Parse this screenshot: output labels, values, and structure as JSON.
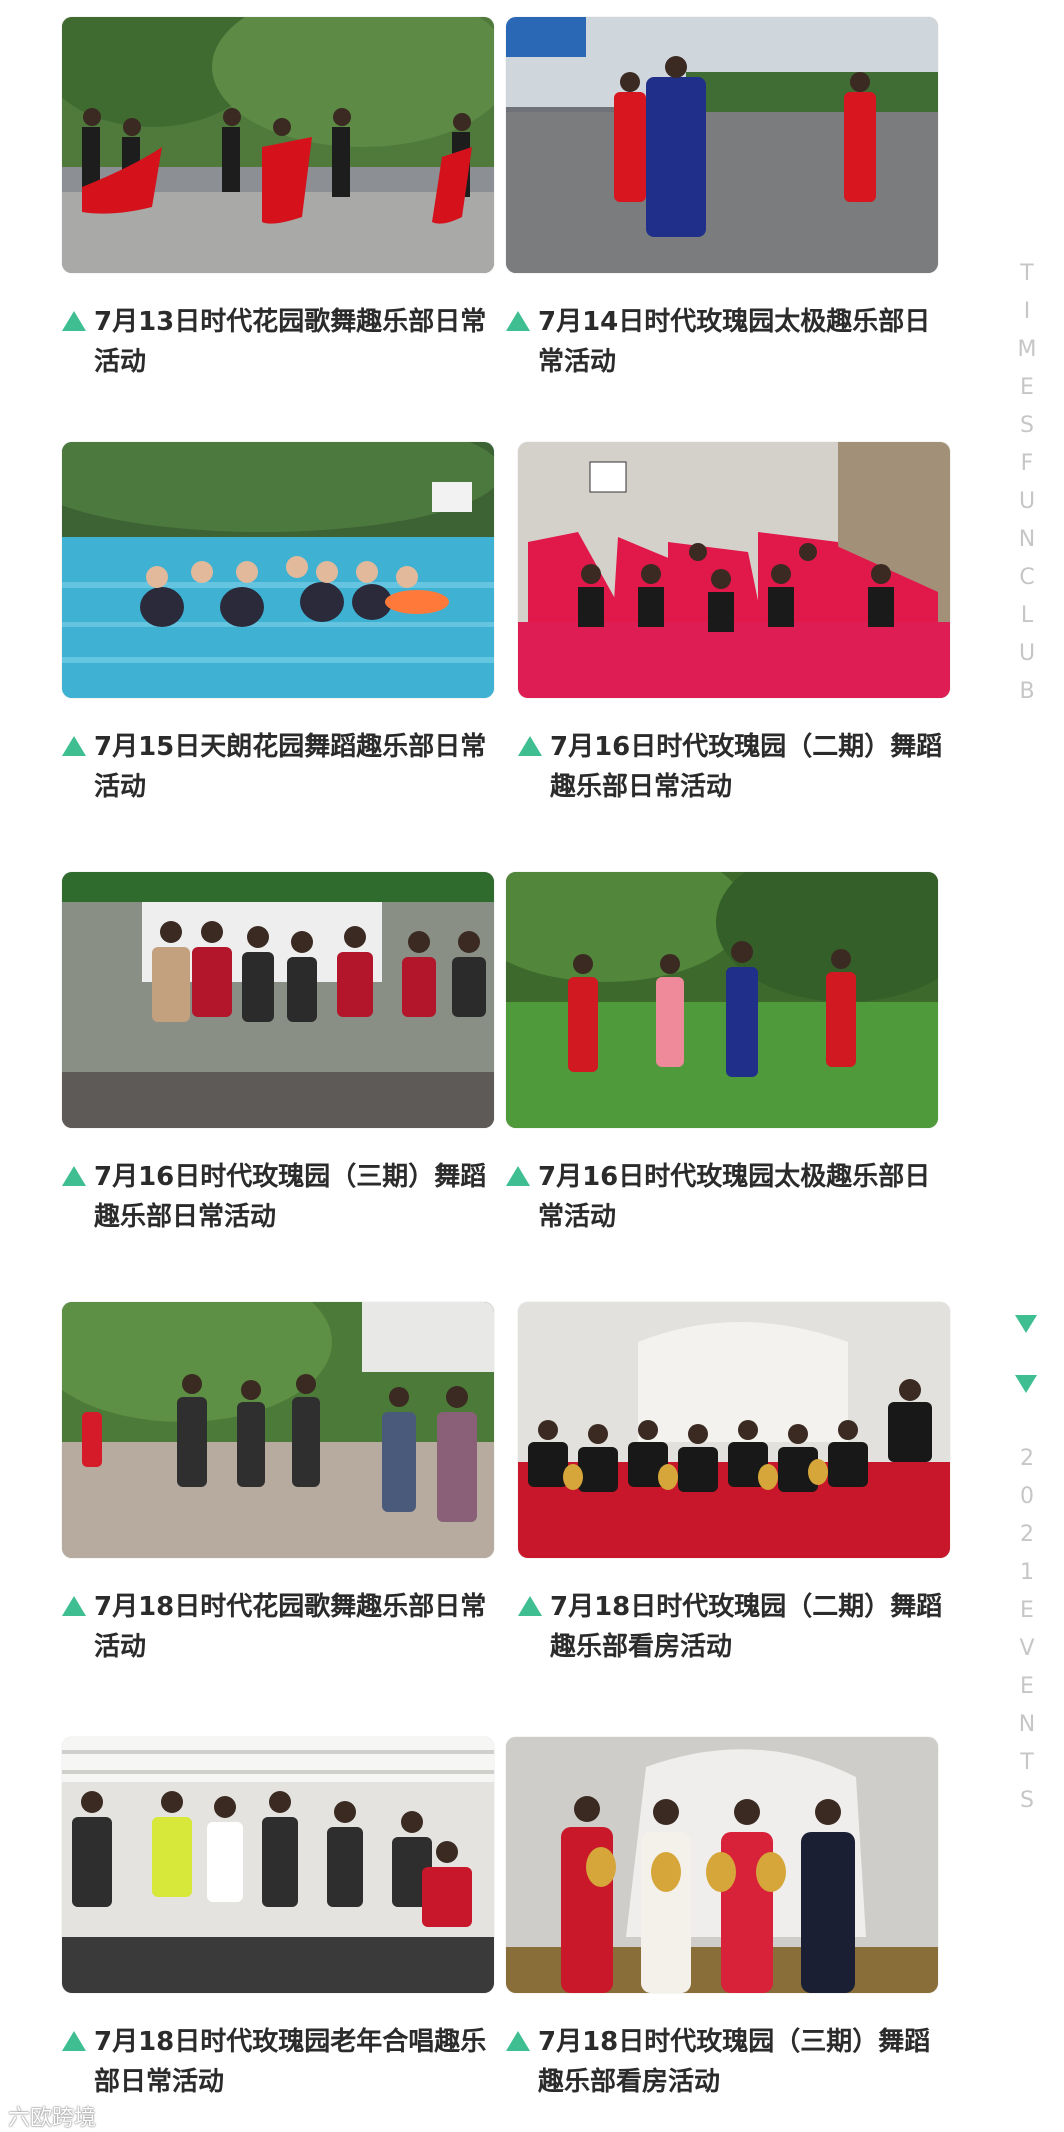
{
  "side_text_top": [
    "T",
    "I",
    "M",
    "E",
    "S",
    "F",
    "U",
    "N",
    "C",
    "L",
    "U",
    "B"
  ],
  "side_text_bottom": [
    "2",
    "0",
    "2",
    "1",
    "E",
    "V",
    "E",
    "N",
    "T",
    "S"
  ],
  "watermark": "六欧跨境",
  "colors": {
    "accent": "#3fbf91",
    "caption": "#2b2b2b",
    "side_text": "#c6c6c6"
  },
  "events": [
    {
      "caption": "7月13日时代花园歌舞趣乐部日常活动",
      "photo": "dance-garden-red-skirts"
    },
    {
      "caption": "7月14日时代玫瑰园太极趣乐部日常活动",
      "photo": "taichi-parking-lot"
    },
    {
      "caption": "7月15日天朗花园舞蹈趣乐部日常活动",
      "photo": "swimming-pool-group"
    },
    {
      "caption": "7月16日时代玫瑰园（二期）舞蹈趣乐部日常活动",
      "photo": "red-fan-dancers-lobby"
    },
    {
      "caption": "7月16日时代玫瑰园（三期）舞蹈趣乐部日常活动",
      "photo": "group-photo-notice-board"
    },
    {
      "caption": "7月16日时代玫瑰园太极趣乐部日常活动",
      "photo": "taichi-lawn"
    },
    {
      "caption": "7月18日时代花园歌舞趣乐部日常活动",
      "photo": "fan-dance-courtyard"
    },
    {
      "caption": "7月18日时代玫瑰园（二期）舞蹈趣乐部看房活动",
      "photo": "sales-center-group"
    },
    {
      "caption": "7月18日时代玫瑰园老年合唱趣乐部日常活动",
      "photo": "choir-room"
    },
    {
      "caption": "7月18日时代玫瑰园（三期）舞蹈趣乐部看房活动",
      "photo": "golden-eggs-showroom"
    }
  ]
}
